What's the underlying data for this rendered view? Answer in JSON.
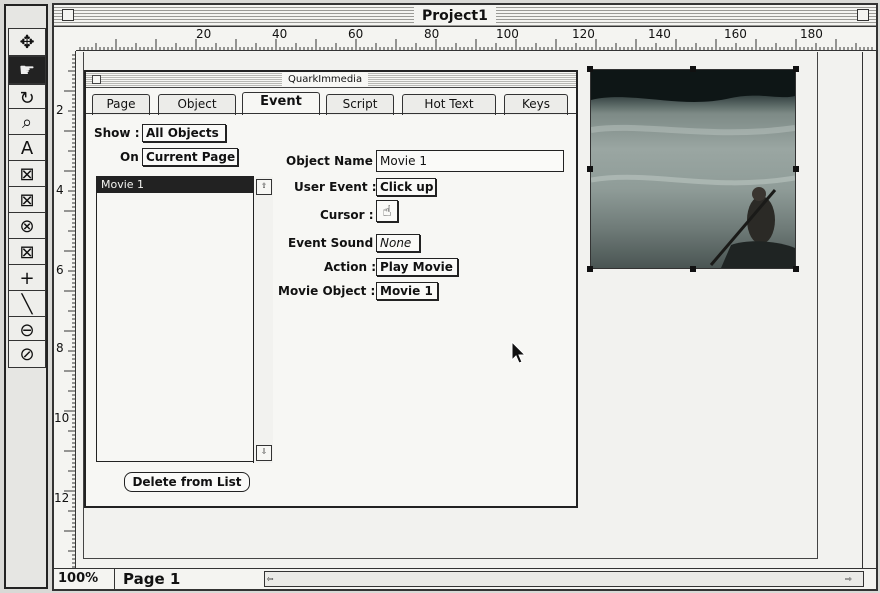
{
  "window": {
    "title": "Project1"
  },
  "tools": [
    {
      "icon": "move-icon",
      "glyph": "✥"
    },
    {
      "icon": "content-hand-icon",
      "glyph": "☛"
    },
    {
      "icon": "rotate-icon",
      "glyph": "↻"
    },
    {
      "icon": "zoom-icon",
      "glyph": "🔍"
    },
    {
      "icon": "text-box-icon",
      "glyph": "A"
    },
    {
      "icon": "rect-picture-box-icon",
      "glyph": "⊠"
    },
    {
      "icon": "rounded-picture-box-icon",
      "glyph": "⊠"
    },
    {
      "icon": "oval-picture-box-icon",
      "glyph": "⊗"
    },
    {
      "icon": "polygon-picture-box-icon",
      "glyph": "⊠"
    },
    {
      "icon": "orthogonal-line-icon",
      "glyph": "+"
    },
    {
      "icon": "line-icon",
      "glyph": "╲"
    },
    {
      "icon": "link-icon",
      "glyph": "⊖"
    },
    {
      "icon": "unlink-icon",
      "glyph": "⊘"
    }
  ],
  "ruler": {
    "horizontal": [
      "20",
      "40",
      "60",
      "80",
      "100",
      "120",
      "140",
      "160",
      "180"
    ],
    "vertical": [
      "2",
      "4",
      "6",
      "8",
      "10",
      "12"
    ]
  },
  "status": {
    "zoom": "100%",
    "page": "Page 1"
  },
  "palette": {
    "title": "QuarkImmedia",
    "tabs": [
      "Page",
      "Object",
      "Event",
      "Script",
      "Hot Text",
      "Keys"
    ],
    "active_tab": "Event",
    "show_label": "Show :",
    "show_value": "All Objects",
    "on_label": "On",
    "on_value": "Current Page",
    "list_items": [
      "Movie 1"
    ],
    "delete_label": "Delete from List",
    "object_name_label": "Object Name :",
    "object_name_value": "Movie 1",
    "user_event_label": "User Event :",
    "user_event_value": "Click up",
    "cursor_label": "Cursor :",
    "cursor_icon": "pointing-hand-icon",
    "event_sound_label": "Event Sound :",
    "event_sound_value": "None",
    "action_label": "Action :",
    "action_value": "Play Movie",
    "movie_object_label": "Movie Object :",
    "movie_object_value": "Movie 1"
  }
}
